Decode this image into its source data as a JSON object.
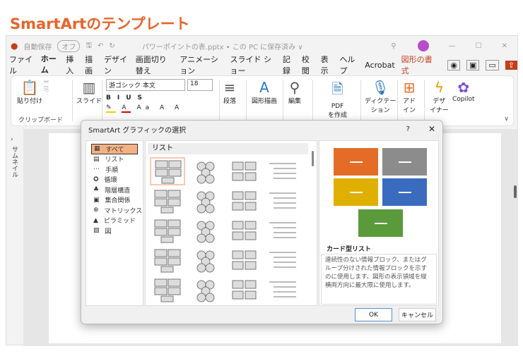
{
  "heading": "SmartArtのテンプレート",
  "titlebar": {
    "autosave": "自動保存",
    "toggle": "オフ",
    "filename": "パワーポイントの表.pptx • この PC に保存済み ∨"
  },
  "tabs": [
    "ファイル",
    "ホーム",
    "挿入",
    "描画",
    "デザイン",
    "画面切り替え",
    "アニメーション",
    "スライド ショー",
    "記録",
    "校閲",
    "表示",
    "ヘルプ",
    "Acrobat",
    "図形の書式"
  ],
  "ribbon": {
    "paste": "貼り付け",
    "clipboard": "クリップボード",
    "slide": "スライド",
    "font_name": "游ゴシック 本文",
    "font_size": "18",
    "paragraph": "段落",
    "drawing": "図形描画",
    "editing": "編集",
    "pdf": "PDF",
    "pdf2": "を作成",
    "dictate": "ディクテー",
    "dictate2": "ション",
    "addin": "アド",
    "addin2": "イン",
    "designer": "デザ",
    "designer2": "イナー",
    "copilot": "Copilot"
  },
  "leftbar": {
    "label": "サムネイル"
  },
  "dialog": {
    "title": "SmartArt グラフィックの選択",
    "help": "?",
    "close": "✕",
    "categories": [
      "すべて",
      "リスト",
      "手順",
      "循環",
      "階層構造",
      "集合関係",
      "マトリックス",
      "ピラミッド",
      "図"
    ],
    "gallery_heading": "リスト",
    "preview_name": "カード型リスト",
    "preview_desc": "連続性のない情報ブロック、またはグループ分けされた情報ブロックを示すのに使用します。図形の表示領域を縦横両方向に最大限に使用します。",
    "preview_colors": [
      "#e46c26",
      "#8c8c8c",
      "#e0b000",
      "#3a6bbf",
      "#5a9a3a"
    ],
    "ok": "OK",
    "cancel": "キャンセル"
  }
}
